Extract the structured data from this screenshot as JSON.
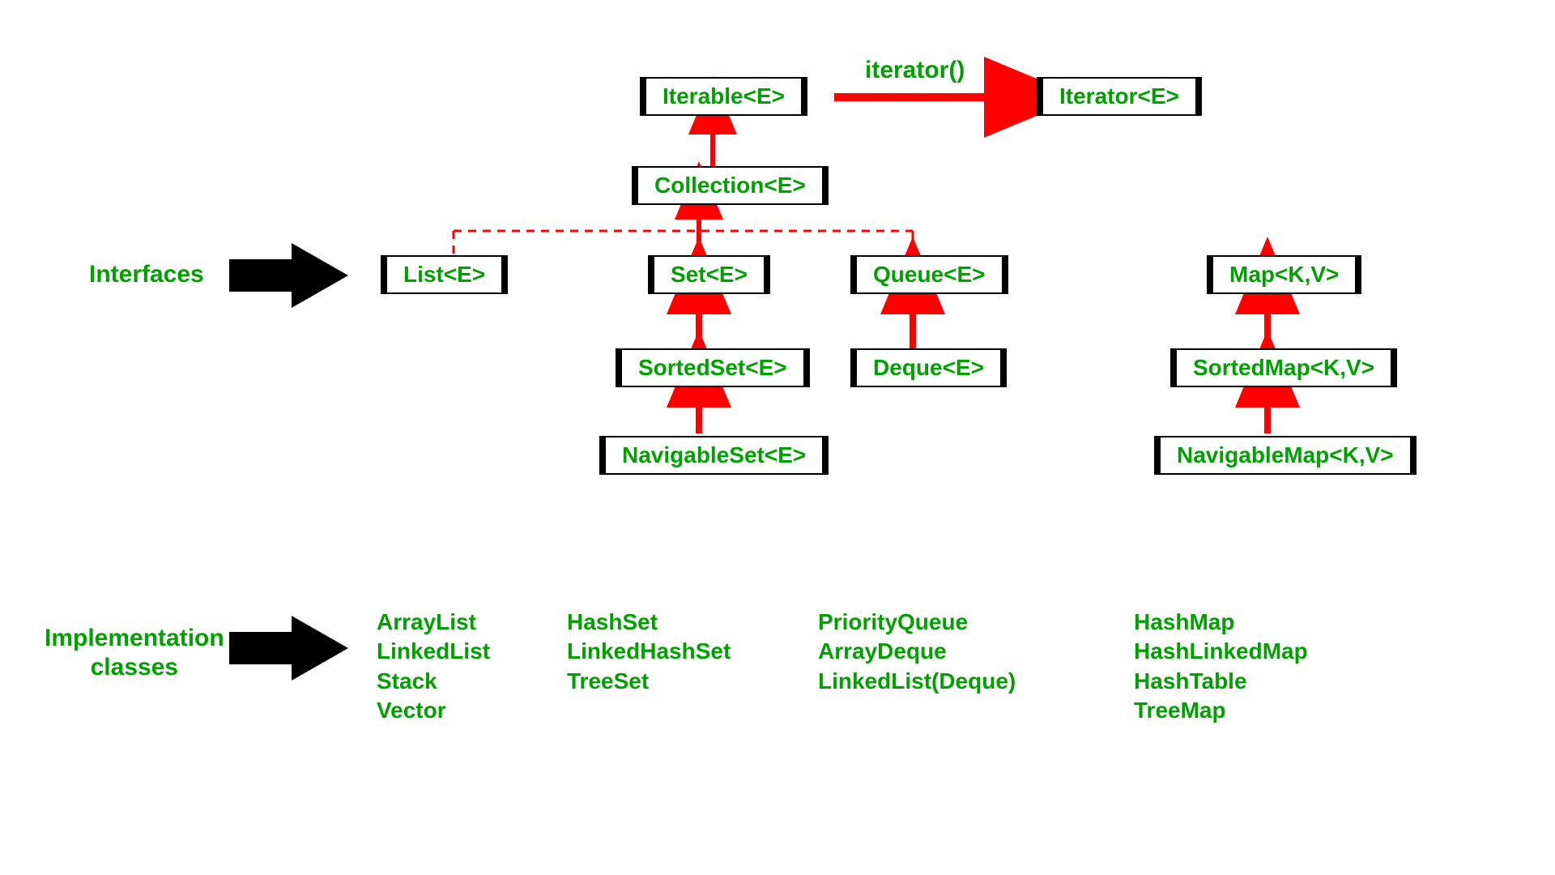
{
  "labels": {
    "interfaces": "Interfaces",
    "implementation": "Implementation\nclasses",
    "iterator_method": "iterator()"
  },
  "boxes": {
    "iterable": "Iterable<E>",
    "iterator": "Iterator<E>",
    "collection": "Collection<E>",
    "list": "List<E>",
    "set": "Set<E>",
    "queue": "Queue<E>",
    "sortedset": "SortedSet<E>",
    "deque": "Deque<E>",
    "navigableset": "NavigableSet<E>",
    "map": "Map<K,V>",
    "sortedmap": "SortedMap<K,V>",
    "navigablemap": "NavigableMap<K,V>"
  },
  "implementations": {
    "list": [
      "ArrayList",
      "LinkedList",
      "Stack",
      "Vector"
    ],
    "set": [
      "HashSet",
      "LinkedHashSet",
      "TreeSet"
    ],
    "queue": [
      "PriorityQueue",
      "ArrayDeque",
      "LinkedList(Deque)"
    ],
    "map": [
      "HashMap",
      "HashLinkedMap",
      "HashTable",
      "TreeMap"
    ]
  }
}
